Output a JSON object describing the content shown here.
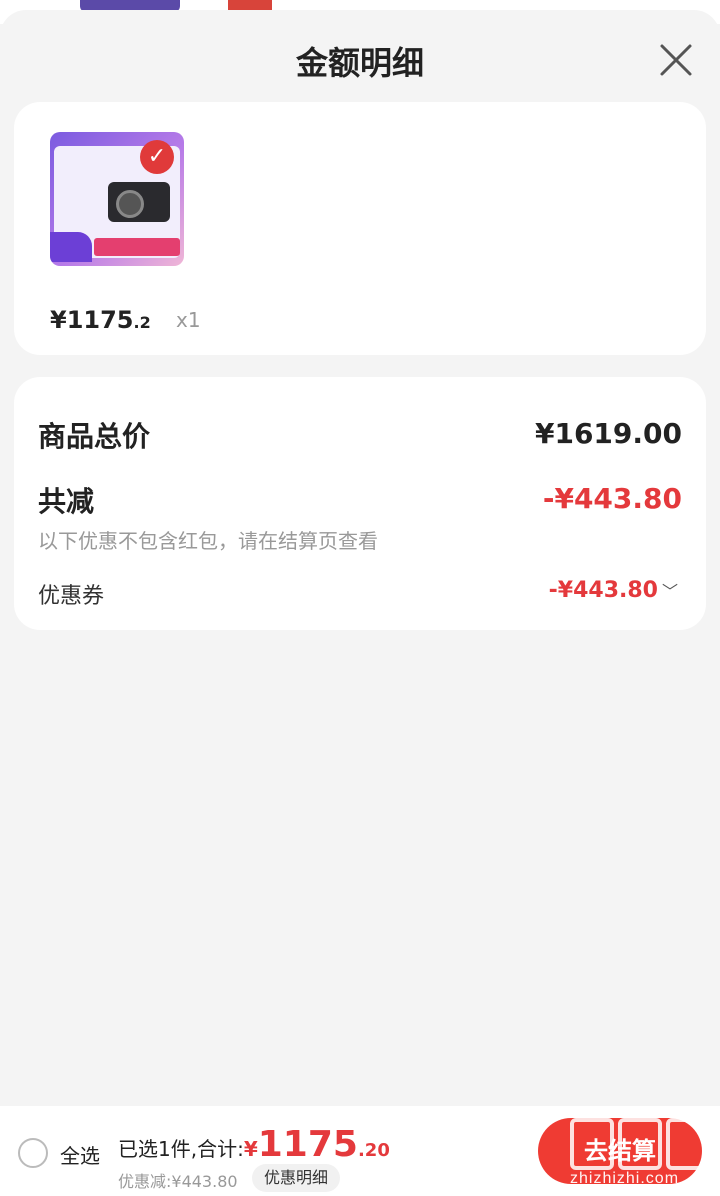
{
  "sheet": {
    "title": "金额明细"
  },
  "product": {
    "price_currency": "¥",
    "price_int": "1175",
    "price_dec": ".2",
    "quantity": "x1"
  },
  "summary": {
    "total_label": "商品总价",
    "total_value": "¥1619.00",
    "reduce_label": "共减",
    "reduce_value": "-¥443.80",
    "note": "以下优惠不包含红包，请在结算页查看",
    "coupon_label": "优惠券",
    "coupon_value": "-¥443.80"
  },
  "bottom": {
    "select_all": "全选",
    "selected_text": "已选1件,合计:",
    "currency": "¥",
    "total_int": "1175",
    "total_dec": ".20",
    "discount_text": "优惠减:¥443.80",
    "detail_pill": "优惠明细",
    "settle_label": "去结算"
  },
  "watermark": {
    "text": "zhizhizhi.com"
  },
  "colors": {
    "accent_red": "#e4393c",
    "button_red": "#ef3b33",
    "background": "#f4f4f4"
  }
}
